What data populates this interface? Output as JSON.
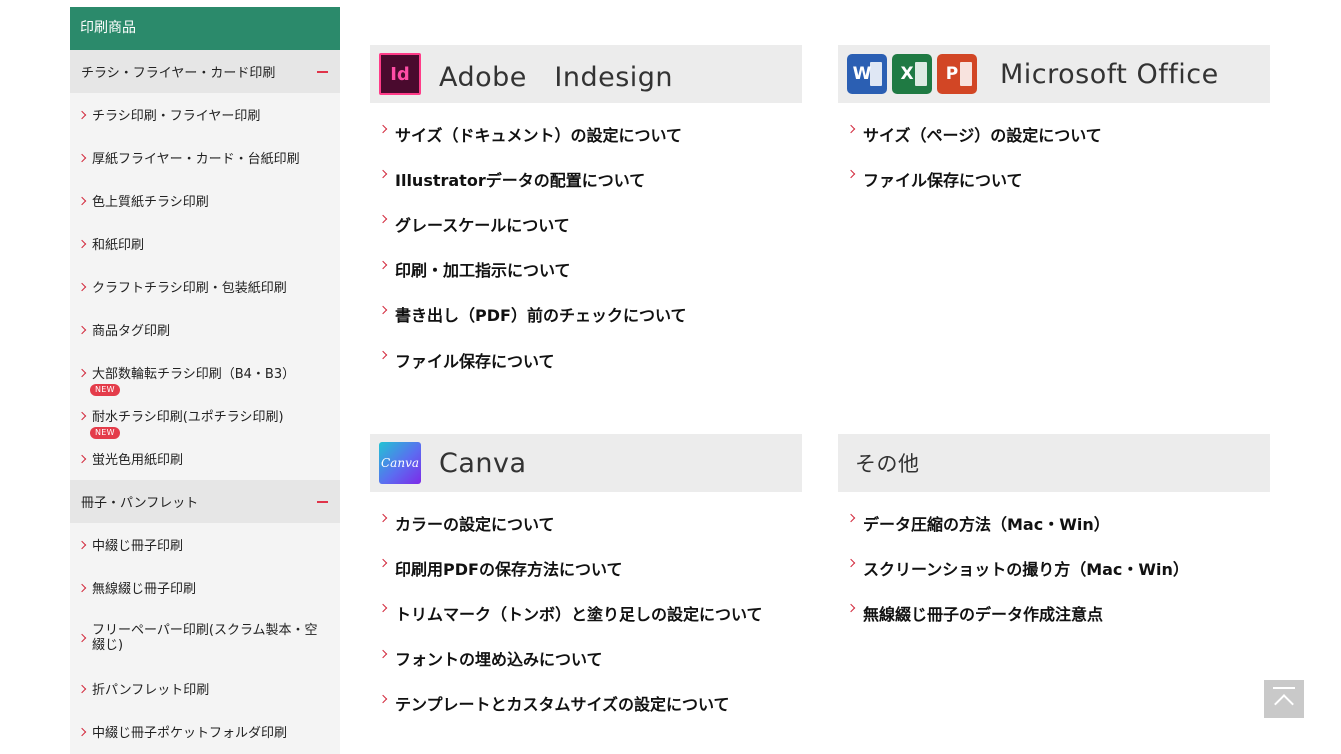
{
  "sidebar": {
    "header": "印刷商品",
    "categories": [
      {
        "label": "チラシ・フライヤー・カード印刷",
        "items": [
          {
            "label": "チラシ印刷・フライヤー印刷"
          },
          {
            "label": "厚紙フライヤー・カード・台紙印刷"
          },
          {
            "label": "色上質紙チラシ印刷"
          },
          {
            "label": "和紙印刷"
          },
          {
            "label": "クラフトチラシ印刷・包装紙印刷"
          },
          {
            "label": "商品タグ印刷"
          },
          {
            "label": "大部数輪転チラシ印刷（B4・B3）"
          },
          {
            "label": "耐水チラシ印刷(ユポチラシ印刷)",
            "badge": "NEW"
          },
          {
            "label": "蛍光色用紙印刷",
            "badge": "NEW"
          }
        ]
      },
      {
        "label": "冊子・パンフレット",
        "items": [
          {
            "label": "中綴じ冊子印刷"
          },
          {
            "label": "無線綴じ冊子印刷"
          },
          {
            "label": "フリーペーパー印刷(スクラム製本・空綴じ)"
          },
          {
            "label": "折パンフレット印刷"
          },
          {
            "label": "中綴じ冊子ポケットフォルダ印刷"
          }
        ]
      }
    ]
  },
  "panels": {
    "indesign": {
      "icon_label": "Id",
      "title": "Adobe　Indesign",
      "links": [
        "サイズ（ドキュメント）の設定について",
        "Illustratorデータの配置について",
        "グレースケールについて",
        "印刷・加工指示について",
        "書き出し（PDF）前のチェックについて",
        "ファイル保存について"
      ]
    },
    "office": {
      "icon_labels": [
        "W",
        "X",
        "P"
      ],
      "title": "Microsoft Office",
      "links": [
        "サイズ（ページ）の設定について",
        "ファイル保存について"
      ]
    },
    "canva": {
      "icon_label": "Canva",
      "title": "Canva",
      "links": [
        "カラーの設定について",
        "印刷用PDFの保存方法について",
        "トリムマーク（トンボ）と塗り足しの設定について",
        "フォントの埋め込みについて",
        "テンプレートとカスタムサイズの設定について"
      ]
    },
    "other": {
      "title": "その他",
      "links": [
        "データ圧縮の方法（Mac・Win）",
        "スクリーンショットの撮り方（Mac・Win）",
        "無線綴じ冊子のデータ作成注意点"
      ]
    }
  },
  "colors": {
    "sidebar_header": "#2b8a6b",
    "accent_red": "#d2283c",
    "badge": "#e43c4a"
  },
  "icons": {
    "back_to_top": "arrow-up-to-top-icon"
  }
}
